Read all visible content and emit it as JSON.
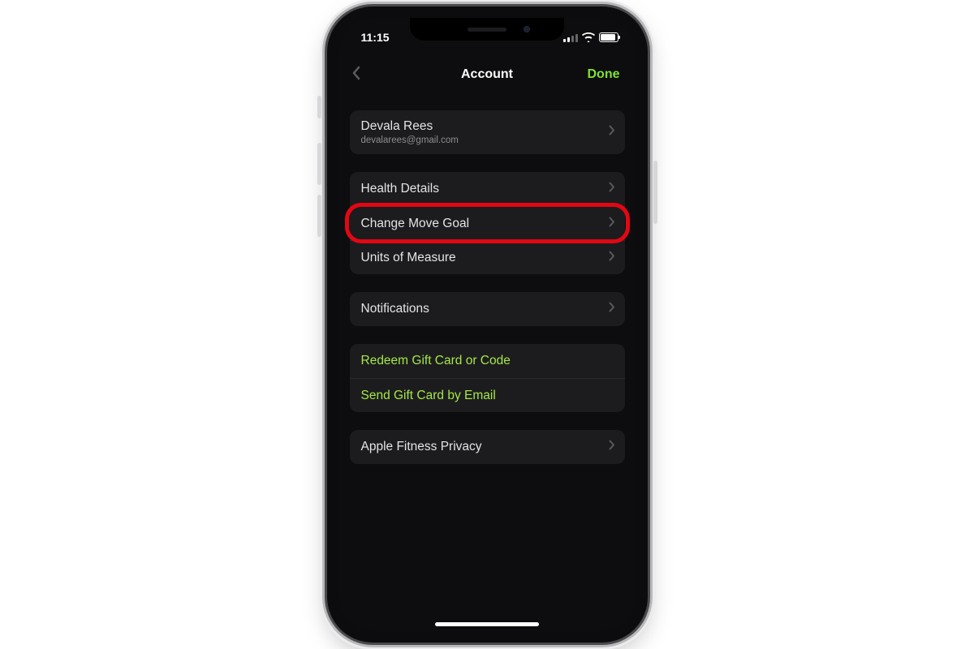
{
  "status": {
    "time": "11:15"
  },
  "nav": {
    "title": "Account",
    "done": "Done"
  },
  "profile": {
    "name": "Devala Rees",
    "email": "devalarees@gmail.com"
  },
  "health": {
    "details": "Health Details",
    "change_move_goal": "Change Move Goal",
    "units": "Units of Measure"
  },
  "notifications": {
    "label": "Notifications"
  },
  "gift": {
    "redeem": "Redeem Gift Card or Code",
    "send": "Send Gift Card by Email"
  },
  "privacy": {
    "label": "Apple Fitness Privacy"
  }
}
